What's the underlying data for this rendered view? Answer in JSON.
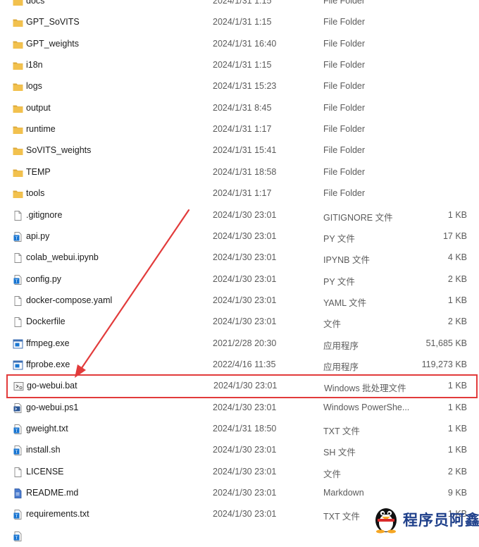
{
  "files": [
    {
      "name": "docs",
      "date": "2024/1/31 1:15",
      "type": "File Folder",
      "size": "",
      "icon": "folder-icon"
    },
    {
      "name": "GPT_SoVITS",
      "date": "2024/1/31 1:15",
      "type": "File Folder",
      "size": "",
      "icon": "folder-icon"
    },
    {
      "name": "GPT_weights",
      "date": "2024/1/31 16:40",
      "type": "File Folder",
      "size": "",
      "icon": "folder-icon"
    },
    {
      "name": "i18n",
      "date": "2024/1/31 1:15",
      "type": "File Folder",
      "size": "",
      "icon": "folder-icon"
    },
    {
      "name": "logs",
      "date": "2024/1/31 15:23",
      "type": "File Folder",
      "size": "",
      "icon": "folder-icon"
    },
    {
      "name": "output",
      "date": "2024/1/31 8:45",
      "type": "File Folder",
      "size": "",
      "icon": "folder-icon"
    },
    {
      "name": "runtime",
      "date": "2024/1/31 1:17",
      "type": "File Folder",
      "size": "",
      "icon": "folder-icon"
    },
    {
      "name": "SoVITS_weights",
      "date": "2024/1/31 15:41",
      "type": "File Folder",
      "size": "",
      "icon": "folder-icon"
    },
    {
      "name": "TEMP",
      "date": "2024/1/31 18:58",
      "type": "File Folder",
      "size": "",
      "icon": "folder-icon"
    },
    {
      "name": "tools",
      "date": "2024/1/31 1:17",
      "type": "File Folder",
      "size": "",
      "icon": "folder-icon"
    },
    {
      "name": ".gitignore",
      "date": "2024/1/30 23:01",
      "type": "GITIGNORE 文件",
      "size": "1 KB",
      "icon": "blank-file-icon"
    },
    {
      "name": "api.py",
      "date": "2024/1/30 23:01",
      "type": "PY 文件",
      "size": "17 KB",
      "icon": "text-file-icon"
    },
    {
      "name": "colab_webui.ipynb",
      "date": "2024/1/30 23:01",
      "type": "IPYNB 文件",
      "size": "4 KB",
      "icon": "blank-file-icon"
    },
    {
      "name": "config.py",
      "date": "2024/1/30 23:01",
      "type": "PY 文件",
      "size": "2 KB",
      "icon": "text-file-icon"
    },
    {
      "name": "docker-compose.yaml",
      "date": "2024/1/30 23:01",
      "type": "YAML 文件",
      "size": "1 KB",
      "icon": "blank-file-icon"
    },
    {
      "name": "Dockerfile",
      "date": "2024/1/30 23:01",
      "type": "文件",
      "size": "2 KB",
      "icon": "blank-file-icon"
    },
    {
      "name": "ffmpeg.exe",
      "date": "2021/2/28 20:30",
      "type": "应用程序",
      "size": "51,685 KB",
      "icon": "app-icon"
    },
    {
      "name": "ffprobe.exe",
      "date": "2022/4/16 11:35",
      "type": "应用程序",
      "size": "119,273 KB",
      "icon": "app-icon"
    },
    {
      "name": "go-webui.bat",
      "date": "2024/1/30 23:01",
      "type": "Windows 批处理文件",
      "size": "1 KB",
      "icon": "batch-file-icon",
      "highlighted": true
    },
    {
      "name": "go-webui.ps1",
      "date": "2024/1/30 23:01",
      "type": "Windows PowerShe...",
      "size": "1 KB",
      "icon": "powershell-file-icon"
    },
    {
      "name": "gweight.txt",
      "date": "2024/1/31 18:50",
      "type": "TXT 文件",
      "size": "1 KB",
      "icon": "text-file-icon"
    },
    {
      "name": "install.sh",
      "date": "2024/1/30 23:01",
      "type": "SH 文件",
      "size": "1 KB",
      "icon": "text-file-icon"
    },
    {
      "name": "LICENSE",
      "date": "2024/1/30 23:01",
      "type": "文件",
      "size": "2 KB",
      "icon": "blank-file-icon"
    },
    {
      "name": "README.md",
      "date": "2024/1/30 23:01",
      "type": "Markdown",
      "size": "9 KB",
      "icon": "markdown-file-icon"
    },
    {
      "name": "requirements.txt",
      "date": "2024/1/30 23:01",
      "type": "TXT 文件",
      "size": "1 KB",
      "icon": "text-file-icon"
    },
    {
      "name": "",
      "date": "",
      "type": "",
      "size": "",
      "icon": "text-file-icon"
    }
  ],
  "watermark": {
    "text": "程序员阿鑫"
  },
  "colors": {
    "folder": "#f2c14e",
    "folder_dark": "#dca93a",
    "file_blue": "#1976d2",
    "highlight": "#e23b3b"
  }
}
